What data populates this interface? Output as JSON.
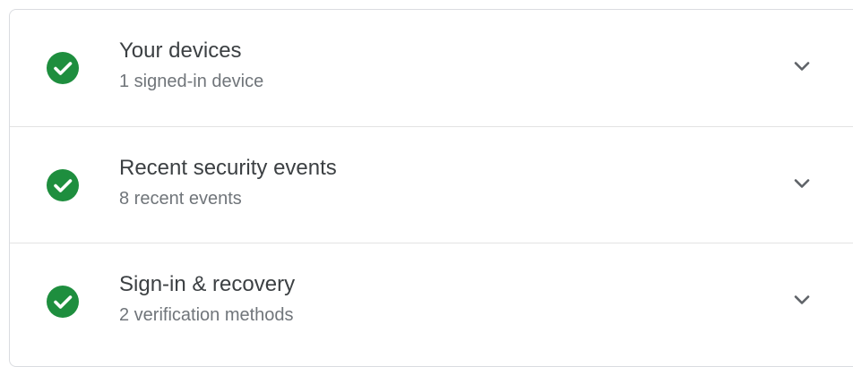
{
  "items": [
    {
      "title": "Your devices",
      "subtitle": "1 signed-in device",
      "status_icon": "check-circle-icon",
      "expand_icon": "chevron-down-icon"
    },
    {
      "title": "Recent security events",
      "subtitle": "8 recent events",
      "status_icon": "check-circle-icon",
      "expand_icon": "chevron-down-icon"
    },
    {
      "title": "Sign-in & recovery",
      "subtitle": "2 verification methods",
      "status_icon": "check-circle-icon",
      "expand_icon": "chevron-down-icon"
    }
  ],
  "colors": {
    "status_ok": "#1e8e3e",
    "title_text": "#3c4043",
    "subtitle_text": "#70757a",
    "divider": "#e3e3e3",
    "chevron": "#5f6368"
  }
}
